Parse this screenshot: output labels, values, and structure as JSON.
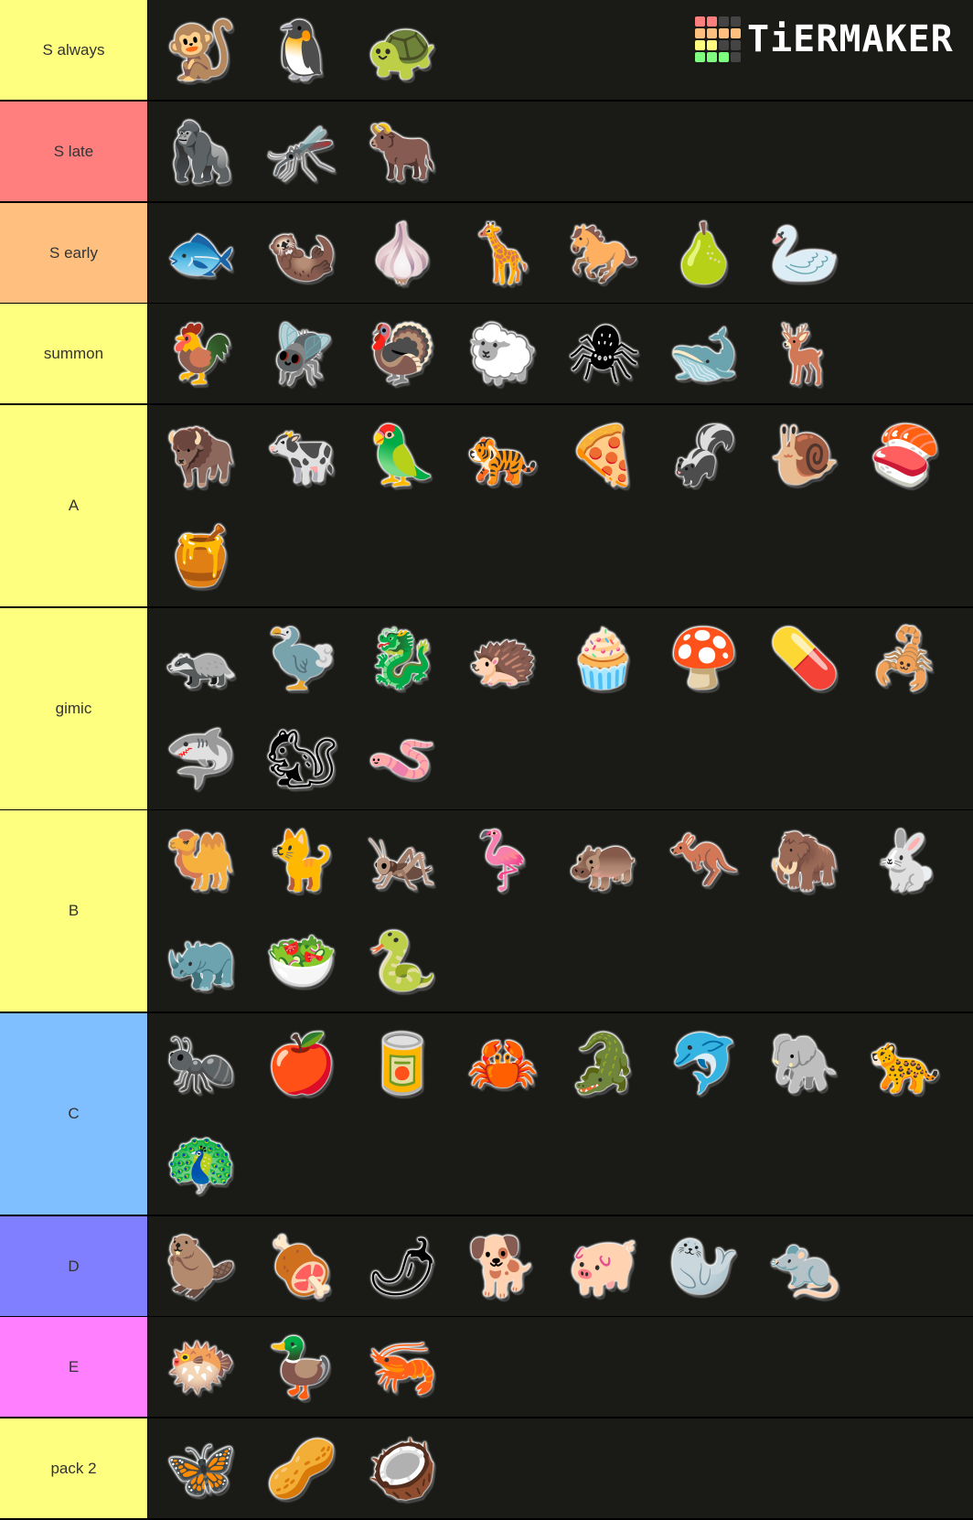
{
  "logo": {
    "text": "TiERMAKER",
    "grid_colors": [
      "#ff7f7f",
      "#ff7f7f",
      "#444444",
      "#444444",
      "#ffbf7f",
      "#ffbf7f",
      "#ffbf7f",
      "#ffbf7f",
      "#ffff7f",
      "#ffff7f",
      "#444444",
      "#444444",
      "#7fff7f",
      "#7fff7f",
      "#7fff7f",
      "#444444"
    ]
  },
  "tiers": [
    {
      "label": "S always",
      "color": "#ffff7f",
      "rows": 1,
      "items": [
        {
          "name": "monkey",
          "glyph": "🐒"
        },
        {
          "name": "penguin",
          "glyph": "🐧"
        },
        {
          "name": "turtle",
          "glyph": "🐢"
        }
      ]
    },
    {
      "label": "S late",
      "color": "#ff7f7f",
      "rows": 1,
      "items": [
        {
          "name": "gorilla",
          "glyph": "🦍"
        },
        {
          "name": "mosquito",
          "glyph": "🦟"
        },
        {
          "name": "ox",
          "glyph": "🐂"
        }
      ]
    },
    {
      "label": "S early",
      "color": "#ffbf7f",
      "rows": 1,
      "items": [
        {
          "name": "fish",
          "glyph": "🐟"
        },
        {
          "name": "otter",
          "glyph": "🦦"
        },
        {
          "name": "garlic",
          "glyph": "🧄"
        },
        {
          "name": "giraffe",
          "glyph": "🦒"
        },
        {
          "name": "horse",
          "glyph": "🐎"
        },
        {
          "name": "pear",
          "glyph": "🍐"
        },
        {
          "name": "swan",
          "glyph": "🦢"
        }
      ]
    },
    {
      "label": "summon",
      "color": "#ffff7f",
      "rows": 1,
      "items": [
        {
          "name": "rooster",
          "glyph": "🐓"
        },
        {
          "name": "fly",
          "glyph": "🪰"
        },
        {
          "name": "turkey",
          "glyph": "🦃"
        },
        {
          "name": "sheep",
          "glyph": "🐑"
        },
        {
          "name": "spider",
          "glyph": "🕷"
        },
        {
          "name": "whale",
          "glyph": "🐋"
        },
        {
          "name": "deer",
          "glyph": "🦌"
        }
      ]
    },
    {
      "label": "A",
      "color": "#ffff7f",
      "rows": 2,
      "items": [
        {
          "name": "bison",
          "glyph": "🦬"
        },
        {
          "name": "cow",
          "glyph": "🐄"
        },
        {
          "name": "parrot",
          "glyph": "🦜"
        },
        {
          "name": "tiger",
          "glyph": "🐅"
        },
        {
          "name": "pizza",
          "glyph": "🍕"
        },
        {
          "name": "skunk",
          "glyph": "🦨"
        },
        {
          "name": "snail",
          "glyph": "🐌"
        },
        {
          "name": "sushi",
          "glyph": "🍣"
        },
        {
          "name": "honey",
          "glyph": "🍯"
        }
      ]
    },
    {
      "label": "gimic",
      "color": "#ffff7f",
      "rows": 2,
      "items": [
        {
          "name": "badger",
          "glyph": "🦡"
        },
        {
          "name": "dodo",
          "glyph": "🦤"
        },
        {
          "name": "dragon",
          "glyph": "🐉"
        },
        {
          "name": "hedgehog",
          "glyph": "🦔"
        },
        {
          "name": "cupcake",
          "glyph": "🧁"
        },
        {
          "name": "mushroom",
          "glyph": "🍄"
        },
        {
          "name": "pill",
          "glyph": "💊"
        },
        {
          "name": "scorpion",
          "glyph": "🦂"
        },
        {
          "name": "shark",
          "glyph": "🦈"
        },
        {
          "name": "chipmunk",
          "glyph": "🐿"
        },
        {
          "name": "worm",
          "glyph": "🪱"
        }
      ]
    },
    {
      "label": "B",
      "color": "#ffff7f",
      "rows": 2,
      "items": [
        {
          "name": "camel",
          "glyph": "🐫"
        },
        {
          "name": "cat",
          "glyph": "🐈"
        },
        {
          "name": "cricket",
          "glyph": "🦗"
        },
        {
          "name": "flamingo",
          "glyph": "🦩"
        },
        {
          "name": "hippo",
          "glyph": "🦛"
        },
        {
          "name": "kangaroo",
          "glyph": "🦘"
        },
        {
          "name": "mammoth",
          "glyph": "🦣"
        },
        {
          "name": "rabbit",
          "glyph": "🐇"
        },
        {
          "name": "rhino",
          "glyph": "🦏"
        },
        {
          "name": "salad",
          "glyph": "🥗"
        },
        {
          "name": "snake",
          "glyph": "🐍"
        }
      ]
    },
    {
      "label": "C",
      "color": "#7fbfff",
      "rows": 2,
      "items": [
        {
          "name": "ant",
          "glyph": "🐜"
        },
        {
          "name": "apple",
          "glyph": "🍎"
        },
        {
          "name": "canned-food",
          "glyph": "🥫"
        },
        {
          "name": "crab",
          "glyph": "🦀"
        },
        {
          "name": "crocodile",
          "glyph": "🐊"
        },
        {
          "name": "dolphin",
          "glyph": "🐬"
        },
        {
          "name": "elephant",
          "glyph": "🐘"
        },
        {
          "name": "leopard",
          "glyph": "🐆"
        },
        {
          "name": "peacock",
          "glyph": "🦚"
        }
      ]
    },
    {
      "label": "D",
      "color": "#7f7fff",
      "rows": 1,
      "items": [
        {
          "name": "beaver",
          "glyph": "🦫"
        },
        {
          "name": "meat",
          "glyph": "🍖"
        },
        {
          "name": "chili",
          "glyph": "🌶"
        },
        {
          "name": "dog",
          "glyph": "🐕"
        },
        {
          "name": "pig",
          "glyph": "🐖"
        },
        {
          "name": "seal",
          "glyph": "🦭"
        },
        {
          "name": "rat",
          "glyph": "🐀"
        }
      ]
    },
    {
      "label": "E",
      "color": "#ff7fff",
      "rows": 1,
      "items": [
        {
          "name": "blowfish",
          "glyph": "🐡"
        },
        {
          "name": "duck",
          "glyph": "🦆"
        },
        {
          "name": "shrimp",
          "glyph": "🦐"
        }
      ]
    },
    {
      "label": "pack 2",
      "color": "#ffff7f",
      "rows": 1,
      "items": [
        {
          "name": "butterfly",
          "glyph": "🦋"
        },
        {
          "name": "peanut",
          "glyph": "🥜"
        },
        {
          "name": "coconut",
          "glyph": "🥥"
        }
      ]
    }
  ]
}
